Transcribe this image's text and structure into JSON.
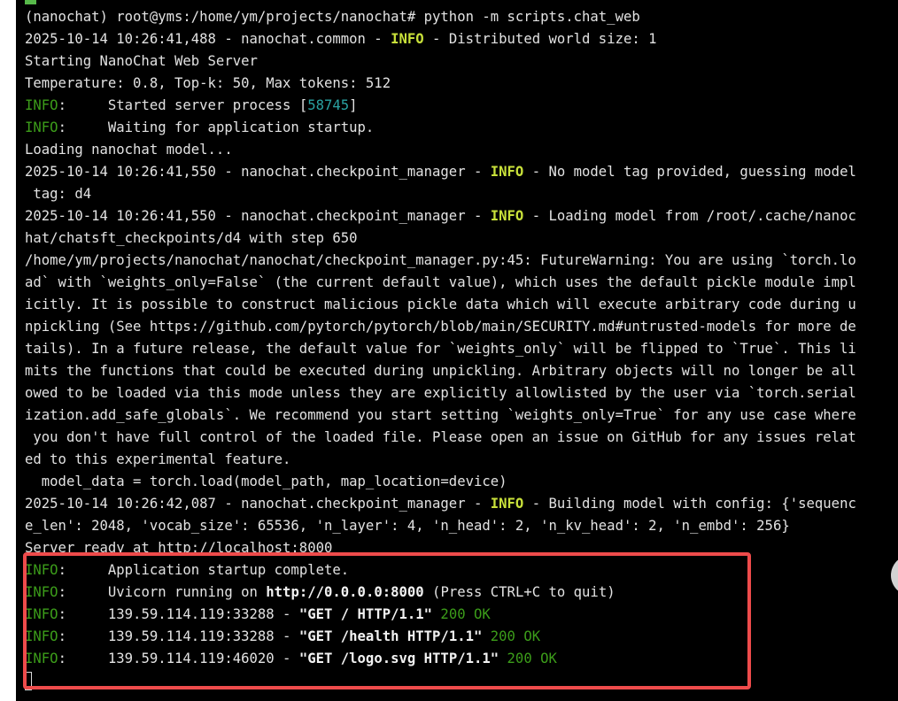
{
  "terminal": {
    "lines": [
      [
        {
          "t": "(nanochat) root@yms:/home/ym/projects/nanochat# python -m scripts.chat_web",
          "c": "c-default"
        }
      ],
      [
        {
          "t": "2025-10-14 10:26:41,488 - nanochat.common - ",
          "c": "c-default"
        },
        {
          "t": "INFO",
          "c": "c-info-bold"
        },
        {
          "t": " - Distributed world size: 1",
          "c": "c-default"
        }
      ],
      [
        {
          "t": "Starting NanoChat Web Server",
          "c": "c-default"
        }
      ],
      [
        {
          "t": "Temperature: 0.8, Top-k: 50, Max tokens: 512",
          "c": "c-default"
        }
      ],
      [
        {
          "t": "INFO",
          "c": "c-green"
        },
        {
          "t": ":     Started server process [",
          "c": "c-default"
        },
        {
          "t": "58745",
          "c": "c-cyan"
        },
        {
          "t": "]",
          "c": "c-default"
        }
      ],
      [
        {
          "t": "INFO",
          "c": "c-green"
        },
        {
          "t": ":     Waiting for application startup.",
          "c": "c-default"
        }
      ],
      [
        {
          "t": "Loading nanochat model...",
          "c": "c-default"
        }
      ],
      [
        {
          "t": "2025-10-14 10:26:41,550 - nanochat.checkpoint_manager - ",
          "c": "c-default"
        },
        {
          "t": "INFO",
          "c": "c-info-bold"
        },
        {
          "t": " - No model tag provided, guessing model",
          "c": "c-default"
        }
      ],
      [
        {
          "t": " tag: d4",
          "c": "c-default"
        }
      ],
      [
        {
          "t": "2025-10-14 10:26:41,550 - nanochat.checkpoint_manager - ",
          "c": "c-default"
        },
        {
          "t": "INFO",
          "c": "c-info-bold"
        },
        {
          "t": " - Loading model from /root/.cache/nanoc",
          "c": "c-default"
        }
      ],
      [
        {
          "t": "hat/chatsft_checkpoints/d4 with step 650",
          "c": "c-default"
        }
      ],
      [
        {
          "t": "/home/ym/projects/nanochat/nanochat/checkpoint_manager.py:45: FutureWarning: You are using `torch.lo",
          "c": "c-default"
        }
      ],
      [
        {
          "t": "ad` with `weights_only=False` (the current default value), which uses the default pickle module impl",
          "c": "c-default"
        }
      ],
      [
        {
          "t": "icitly. It is possible to construct malicious pickle data which will execute arbitrary code during u",
          "c": "c-default"
        }
      ],
      [
        {
          "t": "npickling (See https://github.com/pytorch/pytorch/blob/main/SECURITY.md#untrusted-models for more de",
          "c": "c-default"
        }
      ],
      [
        {
          "t": "tails). In a future release, the default value for `weights_only` will be flipped to `True`. This li",
          "c": "c-default"
        }
      ],
      [
        {
          "t": "mits the functions that could be executed during unpickling. Arbitrary objects will no longer be all",
          "c": "c-default"
        }
      ],
      [
        {
          "t": "owed to be loaded via this mode unless they are explicitly allowlisted by the user via `torch.serial",
          "c": "c-default"
        }
      ],
      [
        {
          "t": "ization.add_safe_globals`. We recommend you start setting `weights_only=True` for any use case where",
          "c": "c-default"
        }
      ],
      [
        {
          "t": " you don't have full control of the loaded file. Please open an issue on GitHub for any issues relat",
          "c": "c-default"
        }
      ],
      [
        {
          "t": "ed to this experimental feature.",
          "c": "c-default"
        }
      ],
      [
        {
          "t": "  model_data = torch.load(model_path, map_location=device)",
          "c": "c-default"
        }
      ],
      [
        {
          "t": "2025-10-14 10:26:42,087 - nanochat.checkpoint_manager - ",
          "c": "c-default"
        },
        {
          "t": "INFO",
          "c": "c-info-bold"
        },
        {
          "t": " - Building model with config: {'sequenc",
          "c": "c-default"
        }
      ],
      [
        {
          "t": "e_len': 2048, 'vocab_size': 65536, 'n_layer': 4, 'n_head': 2, 'n_kv_head': 2, 'n_embd': 256}",
          "c": "c-default"
        }
      ],
      [
        {
          "t": "Server ready at http://localhost:8000",
          "c": "c-default"
        }
      ],
      [
        {
          "t": "INFO",
          "c": "c-green"
        },
        {
          "t": ":     Application startup complete.",
          "c": "c-default"
        }
      ],
      [
        {
          "t": "INFO",
          "c": "c-green"
        },
        {
          "t": ":     Uvicorn running on ",
          "c": "c-default"
        },
        {
          "t": "http://0.0.0.0:8000",
          "c": "c-bold"
        },
        {
          "t": " (Press CTRL+C to quit)",
          "c": "c-default"
        }
      ],
      [
        {
          "t": "INFO",
          "c": "c-green"
        },
        {
          "t": ":     139.59.114.119:33288 - ",
          "c": "c-default"
        },
        {
          "t": "\"GET / HTTP/1.1\"",
          "c": "c-bold"
        },
        {
          "t": " 200 OK",
          "c": "c-green"
        }
      ],
      [
        {
          "t": "INFO",
          "c": "c-green"
        },
        {
          "t": ":     139.59.114.119:33288 - ",
          "c": "c-default"
        },
        {
          "t": "\"GET /health HTTP/1.1\"",
          "c": "c-bold"
        },
        {
          "t": " 200 OK",
          "c": "c-green"
        }
      ],
      [
        {
          "t": "INFO",
          "c": "c-green"
        },
        {
          "t": ":     139.59.114.119:46020 - ",
          "c": "c-default"
        },
        {
          "t": "\"GET /logo.svg HTTP/1.1\"",
          "c": "c-bold"
        },
        {
          "t": " 200 OK",
          "c": "c-green"
        }
      ]
    ]
  },
  "colors": {
    "background": "#000000",
    "text": "#e2e2e2",
    "info_bold": "#c8e03a",
    "green": "#3c9d1a",
    "cyan": "#2aa3a3",
    "highlight": "#ee4b4b"
  }
}
